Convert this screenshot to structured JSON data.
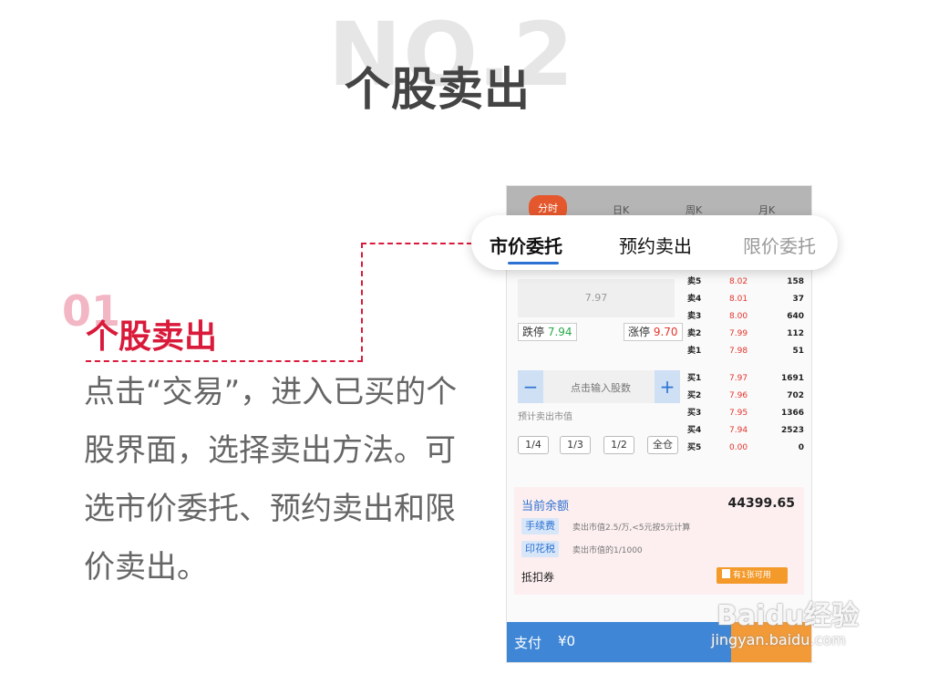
{
  "header": {
    "bg_text": "NO.2",
    "title": "个股卖出"
  },
  "step": {
    "number": "01",
    "title": "个股卖出",
    "description": "点击“交易”，进入已买的个股界面，选择卖出方法。可选市价委托、预约卖出和限价卖出。"
  },
  "phone": {
    "chart_tabs": [
      "分时",
      "日K",
      "周K",
      "月K"
    ],
    "order_tabs": [
      "市价委托",
      "预约卖出",
      "限价委托"
    ],
    "price_placeholder": "7.97",
    "limit_down_label": "跌停",
    "limit_down_value": "7.94",
    "limit_up_label": "涨停",
    "limit_up_value": "9.70",
    "qty_placeholder": "点击输入股数",
    "minus": "−",
    "plus": "+",
    "est_label": "预计卖出市值",
    "fractions": [
      "1/4",
      "1/3",
      "1/2",
      "全仓"
    ],
    "order_book": [
      {
        "label": "卖5",
        "price": "8.02",
        "vol": "158"
      },
      {
        "label": "卖4",
        "price": "8.01",
        "vol": "37"
      },
      {
        "label": "卖3",
        "price": "8.00",
        "vol": "640"
      },
      {
        "label": "卖2",
        "price": "7.99",
        "vol": "112"
      },
      {
        "label": "卖1",
        "price": "7.98",
        "vol": "51"
      },
      {
        "label": "买1",
        "price": "7.97",
        "vol": "1691"
      },
      {
        "label": "买2",
        "price": "7.96",
        "vol": "702"
      },
      {
        "label": "买3",
        "price": "7.95",
        "vol": "1366"
      },
      {
        "label": "买4",
        "price": "7.94",
        "vol": "2523"
      },
      {
        "label": "买5",
        "price": "0.00",
        "vol": "0"
      }
    ],
    "balance_label": "当前余额",
    "balance_value": "44399.65",
    "fee_tag": "手续费",
    "fee_note": "卖出市值2.5/万,<5元按5元计算",
    "stamp_tag": "印花税",
    "stamp_note": "卖出市值的1/1000",
    "deduct_label": "抵扣券",
    "coupon": "有1张可用",
    "pay_label": "支付",
    "pay_amount": "¥0"
  },
  "watermark": {
    "logo": "Baidu经验",
    "url": "jingyan.baidu.com"
  },
  "colors": {
    "accent_red": "#d91a3a",
    "blue": "#2d72d2",
    "orange": "#f29a38"
  }
}
